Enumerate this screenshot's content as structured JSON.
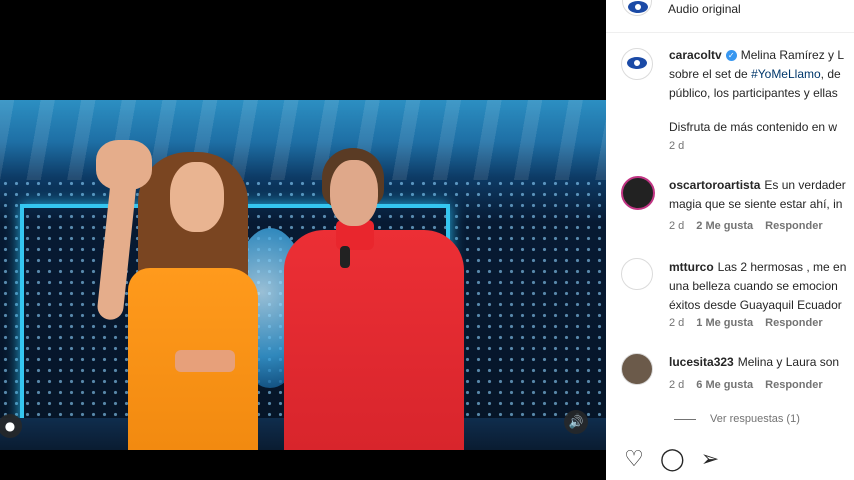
{
  "post": {
    "audio_label": "Audio original"
  },
  "caption": {
    "username": "caracoltv",
    "line1": "Melina Ramírez y L",
    "line2_pre": "sobre el set de ",
    "hashtag": "#YoMeLlamo",
    "line2_post": ", de",
    "line3": "público, los participantes y ellas",
    "line4": "Disfruta de más contenido en w",
    "time": "2 d"
  },
  "comments": [
    {
      "username": "oscartoroartista",
      "line1": "Es un verdader",
      "line2": "magia que se siente estar ahí, in",
      "time": "2 d",
      "likes": "2 Me gusta",
      "reply": "Responder"
    },
    {
      "username": "mtturco",
      "line1": "Las 2 hermosas , me en",
      "line2": "una belleza cuando se emocion",
      "line3": "éxitos desde Guayaquil Ecuador",
      "time": "2 d",
      "likes": "1 Me gusta",
      "reply": "Responder"
    },
    {
      "username": "lucesita323",
      "line1": "Melina y Laura son",
      "time": "2 d",
      "likes": "6 Me gusta",
      "reply": "Responder"
    }
  ],
  "view_replies": "Ver respuestas (1)",
  "icons": {
    "like": "heart-icon",
    "comment": "comment-icon",
    "share": "share-icon"
  }
}
